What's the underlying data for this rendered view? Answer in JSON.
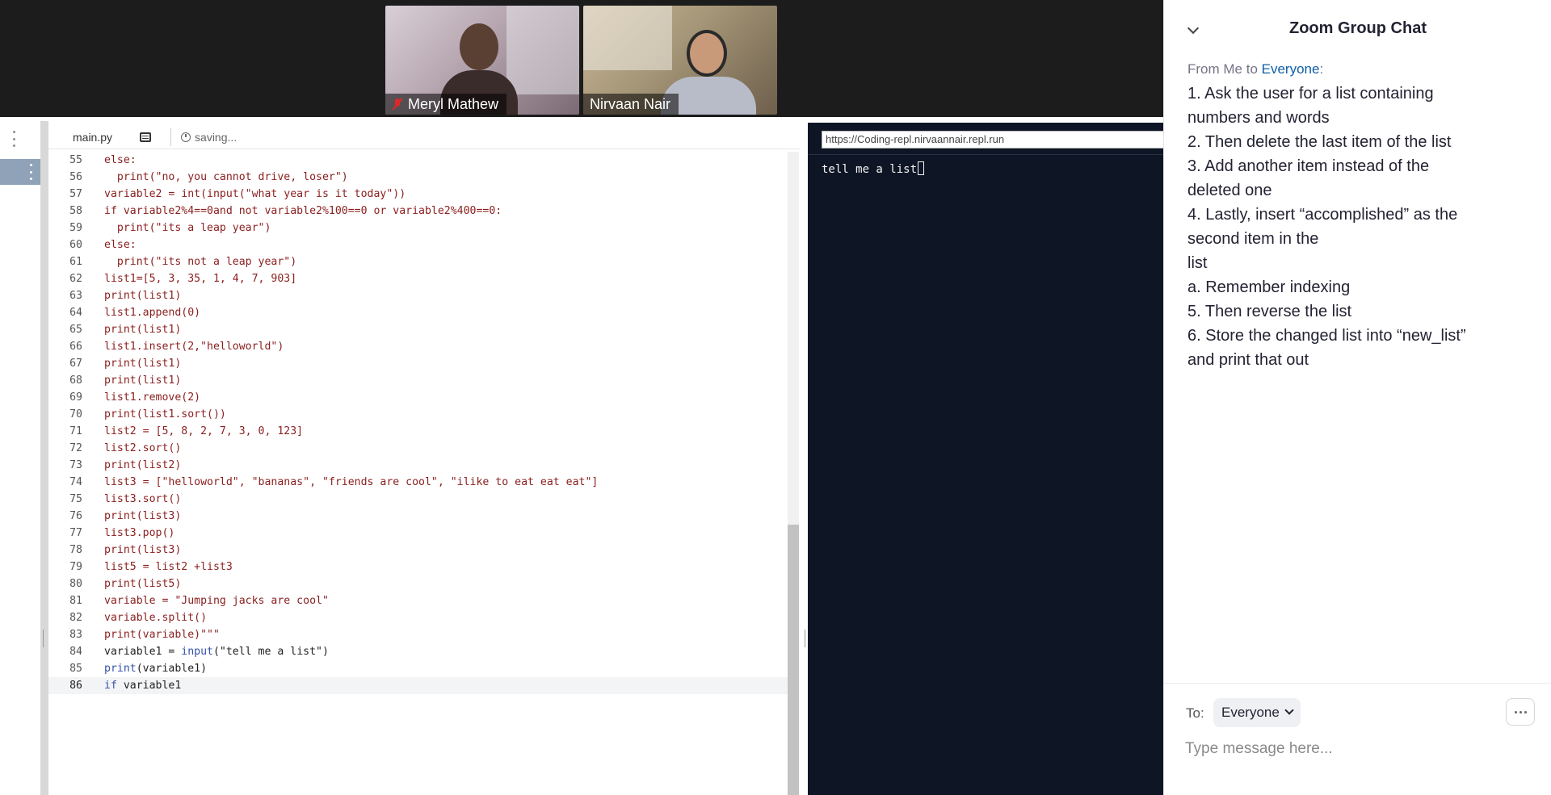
{
  "participants": [
    {
      "name": "Meryl Mathew",
      "muted": true
    },
    {
      "name": "Nirvaan Nair",
      "muted": false
    }
  ],
  "editor": {
    "file_tab": "main.py",
    "status": "saving...",
    "current_line": 86,
    "lines": [
      {
        "n": 55,
        "code": "else:"
      },
      {
        "n": 56,
        "code": "  print(\"no, you cannot drive, loser\")"
      },
      {
        "n": 57,
        "code": "variable2 = int(input(\"what year is it today\"))"
      },
      {
        "n": 58,
        "code": "if variable2%4==0and not variable2%100==0 or variable2%400==0:"
      },
      {
        "n": 59,
        "code": "  print(\"its a leap year\")"
      },
      {
        "n": 60,
        "code": "else:"
      },
      {
        "n": 61,
        "code": "  print(\"its not a leap year\")"
      },
      {
        "n": 62,
        "code": "list1=[5, 3, 35, 1, 4, 7, 903]"
      },
      {
        "n": 63,
        "code": "print(list1)"
      },
      {
        "n": 64,
        "code": "list1.append(0)"
      },
      {
        "n": 65,
        "code": "print(list1)"
      },
      {
        "n": 66,
        "code": "list1.insert(2,\"helloworld\")"
      },
      {
        "n": 67,
        "code": "print(list1)"
      },
      {
        "n": 68,
        "code": "print(list1)"
      },
      {
        "n": 69,
        "code": "list1.remove(2)"
      },
      {
        "n": 70,
        "code": "print(list1.sort())"
      },
      {
        "n": 71,
        "code": "list2 = [5, 8, 2, 7, 3, 0, 123]"
      },
      {
        "n": 72,
        "code": "list2.sort()"
      },
      {
        "n": 73,
        "code": "print(list2)"
      },
      {
        "n": 74,
        "code": "list3 = [\"helloworld\", \"bananas\", \"friends are cool\", \"ilike to eat eat eat\"]"
      },
      {
        "n": 75,
        "code": "list3.sort()"
      },
      {
        "n": 76,
        "code": "print(list3)"
      },
      {
        "n": 77,
        "code": "list3.pop()"
      },
      {
        "n": 78,
        "code": "print(list3)"
      },
      {
        "n": 79,
        "code": "list5 = list2 +list3"
      },
      {
        "n": 80,
        "code": "print(list5)"
      },
      {
        "n": 81,
        "code": "variable = \"Jumping jacks are cool\""
      },
      {
        "n": 82,
        "code": "variable.split()"
      },
      {
        "n": 83,
        "code": "print(variable)\"\"\""
      },
      {
        "n": 84,
        "code": "variable1 = input(\"tell me a list\")",
        "plain": true
      },
      {
        "n": 85,
        "code": "print(variable1)",
        "plain": true
      },
      {
        "n": 86,
        "code": "if variable1",
        "plain": true
      }
    ]
  },
  "console": {
    "url": "https://Coding-repl.nirvaannair.repl.run",
    "output": "tell me a list"
  },
  "chat": {
    "title": "Zoom Group Chat",
    "from_prefix": "From Me to ",
    "recipient": "Everyone",
    "recipient_suffix": ":",
    "message_lines": [
      "1. Ask the user for a list containing",
      "numbers and words",
      "2. Then delete the last item of the list",
      "3. Add another item instead of the",
      "deleted one",
      "4. Lastly, insert “accomplished” as the",
      "second item in the",
      "list",
      "a. Remember indexing",
      "5. Then reverse the list",
      "6. Store the changed list into “new_list”",
      "and print that out"
    ],
    "to_label": "To:",
    "to_value": "Everyone",
    "input_placeholder": "Type message here..."
  }
}
